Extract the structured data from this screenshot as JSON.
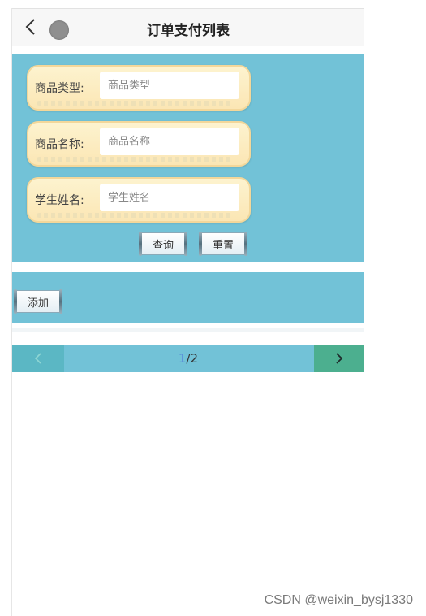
{
  "header": {
    "title": "订单支付列表",
    "back_icon": "chevron-left-icon",
    "status_icon": "circle-dot-icon"
  },
  "search": {
    "fields": [
      {
        "label": "商品类型:",
        "placeholder": "商品类型",
        "value": ""
      },
      {
        "label": "商品名称:",
        "placeholder": "商品名称",
        "value": ""
      },
      {
        "label": "学生姓名:",
        "placeholder": "学生姓名",
        "value": ""
      }
    ],
    "query_label": "查询",
    "reset_label": "重置"
  },
  "actions": {
    "add_label": "添加"
  },
  "pagination": {
    "current": "1",
    "total": "/2",
    "prev_icon": "chevron-left-icon",
    "next_icon": "chevron-right-icon"
  },
  "watermark": "CSDN @weixin_bysj1330",
  "colors": {
    "panel": "#72c2d7",
    "scroll_field": "#fbe6b4",
    "pager_next": "#4caf8f"
  }
}
